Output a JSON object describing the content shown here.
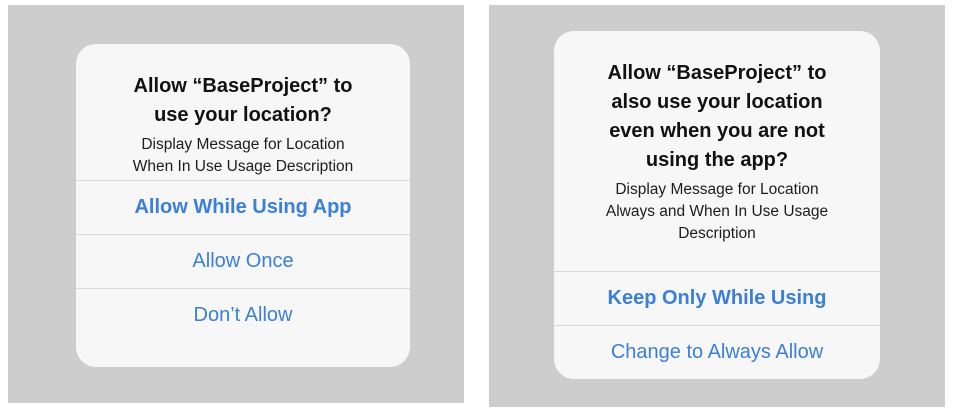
{
  "left_alert": {
    "title_lines": [
      "Allow “BaseProject” to",
      "use your location?"
    ],
    "message_lines": [
      "Display Message for  Location",
      "When In Use Usage Description"
    ],
    "buttons": [
      {
        "label": "Allow While Using App",
        "bold": true
      },
      {
        "label": "Allow Once",
        "bold": false
      },
      {
        "label": "Don’t Allow",
        "bold": false
      }
    ]
  },
  "right_alert": {
    "title_lines": [
      "Allow “BaseProject” to",
      "also use your location",
      "even when you are not",
      "using the app?"
    ],
    "message_lines": [
      "Display Message for Location",
      "Always and When In Use Usage",
      "Description"
    ],
    "buttons": [
      {
        "label": "Keep Only While Using",
        "bold": true
      },
      {
        "label": "Change to Always Allow",
        "bold": false
      }
    ]
  },
  "colors": {
    "background_panel": "#cdcdcd",
    "alert_background": "#f7f7f7",
    "button_text": "#3b7fd8",
    "separator": "#d9d9d9"
  }
}
